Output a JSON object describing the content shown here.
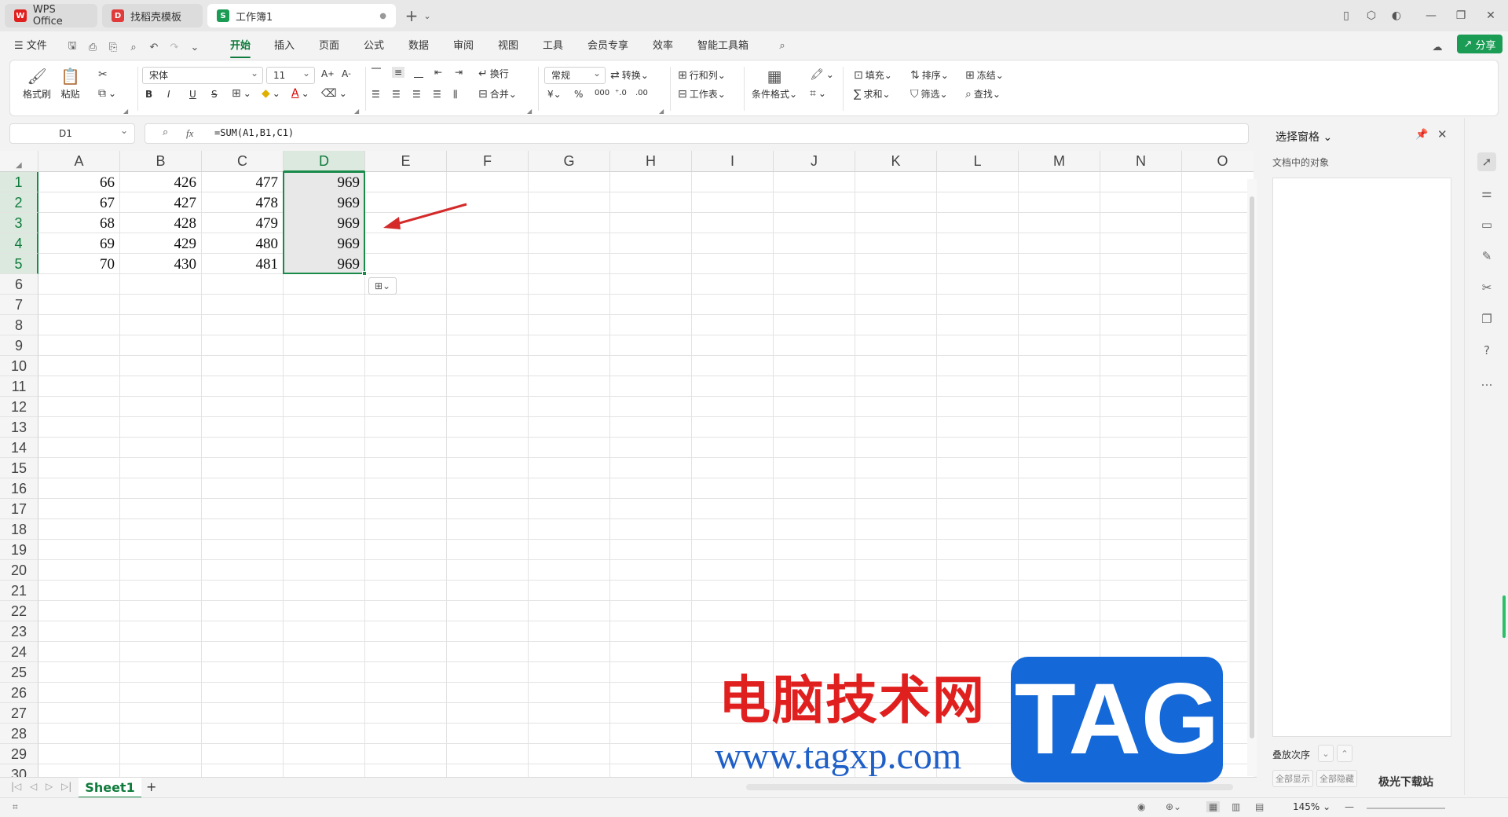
{
  "titlebar": {
    "tabs": [
      {
        "label": "WPS Office",
        "logo": "W",
        "logo_color": "#e0201f"
      },
      {
        "label": "找稻壳模板",
        "logo": "D",
        "logo_color": "#e03a3a"
      },
      {
        "label": "工作簿1",
        "logo": "S",
        "logo_color": "#1a9c55"
      }
    ],
    "new_tab": "+"
  },
  "menubar": {
    "file": "文件",
    "items": [
      "开始",
      "插入",
      "页面",
      "公式",
      "数据",
      "审阅",
      "视图",
      "工具",
      "会员专享",
      "效率",
      "智能工具箱"
    ],
    "active": "开始",
    "share": "分享"
  },
  "ribbon": {
    "format_painter": "格式刷",
    "paste": "粘贴",
    "font_name": "宋体",
    "font_size": "11",
    "bold": "B",
    "italic": "I",
    "underline": "U",
    "strike": "S",
    "wrap": "换行",
    "merge": "合并",
    "number_format": "常规",
    "convert": "转换",
    "row_col": "行和列",
    "worksheet": "工作表",
    "conditional": "条件格式",
    "fill": "填充",
    "sort": "排序",
    "freeze": "冻结",
    "sum": "求和",
    "filter": "筛选",
    "find": "查找",
    "currency": "¥",
    "percent": "%"
  },
  "formula": {
    "cell_ref": "D1",
    "fx": "fx",
    "text": "=SUM(A1,B1,C1)"
  },
  "grid": {
    "columns": [
      "A",
      "B",
      "C",
      "D",
      "E",
      "F",
      "G",
      "H",
      "I",
      "J",
      "K",
      "L",
      "M",
      "N",
      "O"
    ],
    "rows": [
      "1",
      "2",
      "3",
      "4",
      "5",
      "6",
      "7",
      "8",
      "9",
      "10",
      "11",
      "12",
      "13",
      "14",
      "15",
      "16",
      "17",
      "18",
      "19",
      "20",
      "21",
      "22",
      "23",
      "24",
      "25",
      "26",
      "27",
      "28",
      "29",
      "30"
    ],
    "data": [
      [
        "66",
        "426",
        "477",
        "969"
      ],
      [
        "67",
        "427",
        "478",
        "969"
      ],
      [
        "68",
        "428",
        "479",
        "969"
      ],
      [
        "69",
        "429",
        "480",
        "969"
      ],
      [
        "70",
        "430",
        "481",
        "969"
      ]
    ],
    "selected_column": "D"
  },
  "sheets": {
    "active": "Sheet1",
    "add": "+"
  },
  "status": {
    "zoom": "145%"
  },
  "selection_pane": {
    "title": "选择窗格",
    "subtitle": "文档中的对象",
    "stack_order": "叠放次序",
    "show_all": "全部显示",
    "hide_all": "全部隐藏"
  },
  "watermark": {
    "cn_text": "电脑技术网",
    "url": "www.tagxp.com",
    "tag": "TAG",
    "logo_text": "极光下载站"
  },
  "colors": {
    "accent": "#1a8a4a",
    "arrow": "#d42a2a"
  }
}
